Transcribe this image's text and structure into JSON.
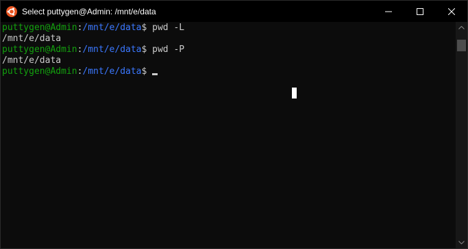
{
  "window": {
    "title": "Select puttygen@Admin: /mnt/e/data",
    "app_icon": "ubuntu-icon",
    "buttons": {
      "minimize_icon": "minimize-icon",
      "maximize_icon": "maximize-icon",
      "close_icon": "close-icon"
    }
  },
  "colors": {
    "background": "#0c0c0c",
    "user": "#13a10e",
    "path": "#3b78ff",
    "text": "#cccccc",
    "ubuntu_orange": "#e95420"
  },
  "terminal": {
    "lines": [
      {
        "user": "puttygen@Admin",
        "sep": ":",
        "path": "/mnt/e/data",
        "prompt": "$ ",
        "command": "pwd -L"
      },
      {
        "output": "/mnt/e/data"
      },
      {
        "user": "puttygen@Admin",
        "sep": ":",
        "path": "/mnt/e/data",
        "prompt": "$ ",
        "command": "pwd -P"
      },
      {
        "output": "/mnt/e/data"
      },
      {
        "user": "puttygen@Admin",
        "sep": ":",
        "path": "/mnt/e/data",
        "prompt": "$ ",
        "command": ""
      }
    ]
  }
}
